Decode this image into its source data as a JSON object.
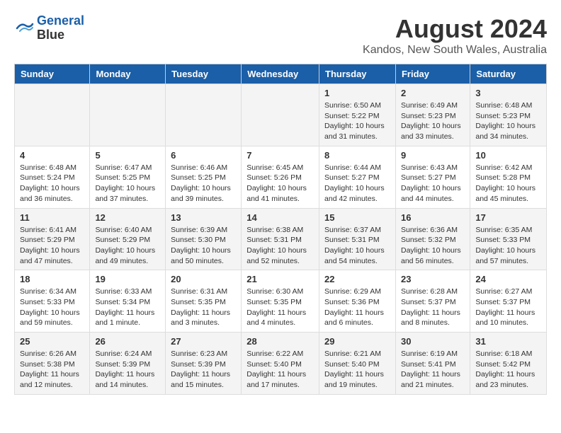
{
  "header": {
    "logo_line1": "General",
    "logo_line2": "Blue",
    "month_year": "August 2024",
    "location": "Kandos, New South Wales, Australia"
  },
  "weekdays": [
    "Sunday",
    "Monday",
    "Tuesday",
    "Wednesday",
    "Thursday",
    "Friday",
    "Saturday"
  ],
  "weeks": [
    [
      {
        "day": "",
        "content": ""
      },
      {
        "day": "",
        "content": ""
      },
      {
        "day": "",
        "content": ""
      },
      {
        "day": "",
        "content": ""
      },
      {
        "day": "1",
        "content": "Sunrise: 6:50 AM\nSunset: 5:22 PM\nDaylight: 10 hours\nand 31 minutes."
      },
      {
        "day": "2",
        "content": "Sunrise: 6:49 AM\nSunset: 5:23 PM\nDaylight: 10 hours\nand 33 minutes."
      },
      {
        "day": "3",
        "content": "Sunrise: 6:48 AM\nSunset: 5:23 PM\nDaylight: 10 hours\nand 34 minutes."
      }
    ],
    [
      {
        "day": "4",
        "content": "Sunrise: 6:48 AM\nSunset: 5:24 PM\nDaylight: 10 hours\nand 36 minutes."
      },
      {
        "day": "5",
        "content": "Sunrise: 6:47 AM\nSunset: 5:25 PM\nDaylight: 10 hours\nand 37 minutes."
      },
      {
        "day": "6",
        "content": "Sunrise: 6:46 AM\nSunset: 5:25 PM\nDaylight: 10 hours\nand 39 minutes."
      },
      {
        "day": "7",
        "content": "Sunrise: 6:45 AM\nSunset: 5:26 PM\nDaylight: 10 hours\nand 41 minutes."
      },
      {
        "day": "8",
        "content": "Sunrise: 6:44 AM\nSunset: 5:27 PM\nDaylight: 10 hours\nand 42 minutes."
      },
      {
        "day": "9",
        "content": "Sunrise: 6:43 AM\nSunset: 5:27 PM\nDaylight: 10 hours\nand 44 minutes."
      },
      {
        "day": "10",
        "content": "Sunrise: 6:42 AM\nSunset: 5:28 PM\nDaylight: 10 hours\nand 45 minutes."
      }
    ],
    [
      {
        "day": "11",
        "content": "Sunrise: 6:41 AM\nSunset: 5:29 PM\nDaylight: 10 hours\nand 47 minutes."
      },
      {
        "day": "12",
        "content": "Sunrise: 6:40 AM\nSunset: 5:29 PM\nDaylight: 10 hours\nand 49 minutes."
      },
      {
        "day": "13",
        "content": "Sunrise: 6:39 AM\nSunset: 5:30 PM\nDaylight: 10 hours\nand 50 minutes."
      },
      {
        "day": "14",
        "content": "Sunrise: 6:38 AM\nSunset: 5:31 PM\nDaylight: 10 hours\nand 52 minutes."
      },
      {
        "day": "15",
        "content": "Sunrise: 6:37 AM\nSunset: 5:31 PM\nDaylight: 10 hours\nand 54 minutes."
      },
      {
        "day": "16",
        "content": "Sunrise: 6:36 AM\nSunset: 5:32 PM\nDaylight: 10 hours\nand 56 minutes."
      },
      {
        "day": "17",
        "content": "Sunrise: 6:35 AM\nSunset: 5:33 PM\nDaylight: 10 hours\nand 57 minutes."
      }
    ],
    [
      {
        "day": "18",
        "content": "Sunrise: 6:34 AM\nSunset: 5:33 PM\nDaylight: 10 hours\nand 59 minutes."
      },
      {
        "day": "19",
        "content": "Sunrise: 6:33 AM\nSunset: 5:34 PM\nDaylight: 11 hours\nand 1 minute."
      },
      {
        "day": "20",
        "content": "Sunrise: 6:31 AM\nSunset: 5:35 PM\nDaylight: 11 hours\nand 3 minutes."
      },
      {
        "day": "21",
        "content": "Sunrise: 6:30 AM\nSunset: 5:35 PM\nDaylight: 11 hours\nand 4 minutes."
      },
      {
        "day": "22",
        "content": "Sunrise: 6:29 AM\nSunset: 5:36 PM\nDaylight: 11 hours\nand 6 minutes."
      },
      {
        "day": "23",
        "content": "Sunrise: 6:28 AM\nSunset: 5:37 PM\nDaylight: 11 hours\nand 8 minutes."
      },
      {
        "day": "24",
        "content": "Sunrise: 6:27 AM\nSunset: 5:37 PM\nDaylight: 11 hours\nand 10 minutes."
      }
    ],
    [
      {
        "day": "25",
        "content": "Sunrise: 6:26 AM\nSunset: 5:38 PM\nDaylight: 11 hours\nand 12 minutes."
      },
      {
        "day": "26",
        "content": "Sunrise: 6:24 AM\nSunset: 5:39 PM\nDaylight: 11 hours\nand 14 minutes."
      },
      {
        "day": "27",
        "content": "Sunrise: 6:23 AM\nSunset: 5:39 PM\nDaylight: 11 hours\nand 15 minutes."
      },
      {
        "day": "28",
        "content": "Sunrise: 6:22 AM\nSunset: 5:40 PM\nDaylight: 11 hours\nand 17 minutes."
      },
      {
        "day": "29",
        "content": "Sunrise: 6:21 AM\nSunset: 5:40 PM\nDaylight: 11 hours\nand 19 minutes."
      },
      {
        "day": "30",
        "content": "Sunrise: 6:19 AM\nSunset: 5:41 PM\nDaylight: 11 hours\nand 21 minutes."
      },
      {
        "day": "31",
        "content": "Sunrise: 6:18 AM\nSunset: 5:42 PM\nDaylight: 11 hours\nand 23 minutes."
      }
    ]
  ]
}
